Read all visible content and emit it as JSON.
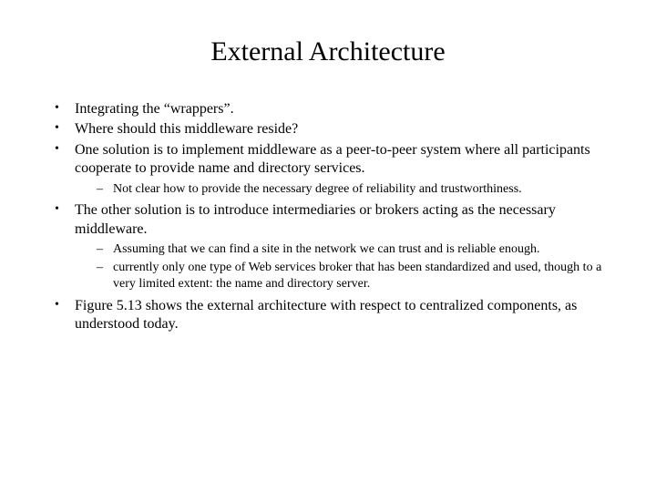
{
  "title": "External Architecture",
  "bullets": {
    "b1": "Integrating the “wrappers”.",
    "b2": "Where should this middleware reside?",
    "b3": "One solution is to implement middleware as a peer-to-peer system where all participants cooperate to provide name and directory services.",
    "b3_s1": "Not clear how to provide the necessary degree of reliability and trustworthiness.",
    "b4": "The other solution is to introduce intermediaries or brokers acting as the necessary middleware.",
    "b4_s1": "Assuming that we can find a site in the network we can trust and is reliable enough.",
    "b4_s2": " currently only one type of Web services broker that has been standardized and used, though to a very limited extent: the name and directory server.",
    "b5": "Figure 5.13 shows the external architecture with respect to centralized components, as understood today."
  }
}
